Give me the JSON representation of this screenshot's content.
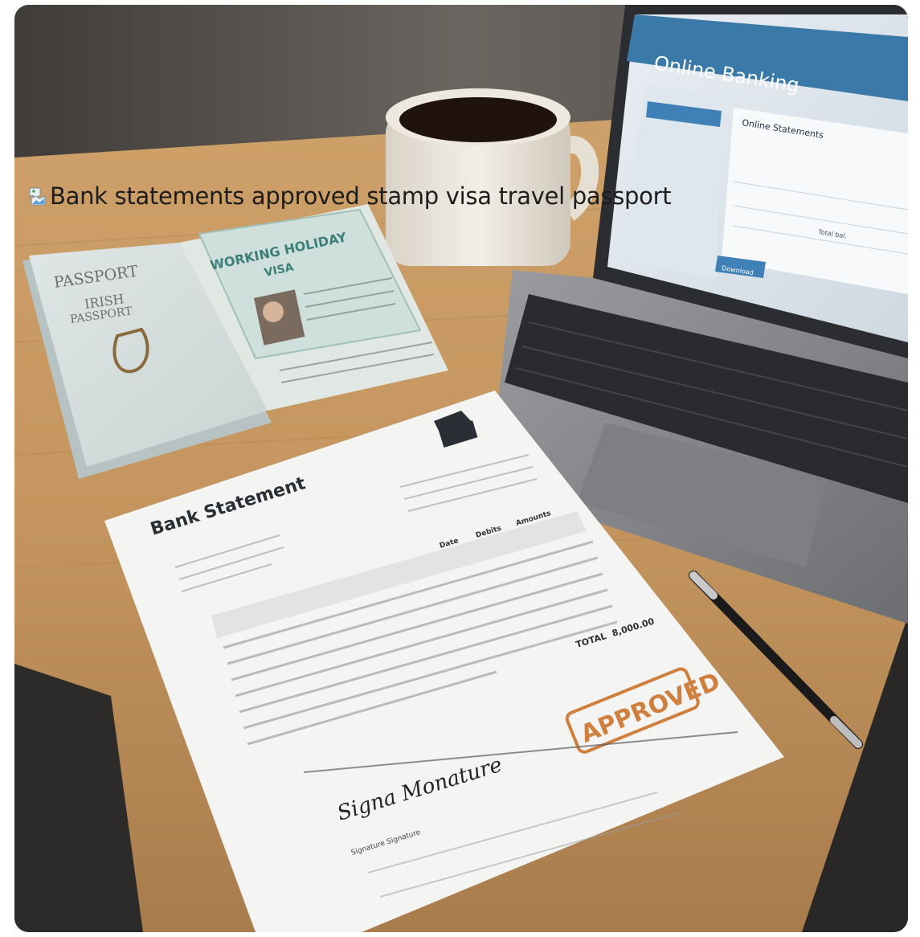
{
  "image": {
    "alt_text": "Bank statements approved stamp visa travel passport",
    "broken_image_icon": "broken-image-icon"
  },
  "scene": {
    "laptop": {
      "title": "Online Banking",
      "panel_heading": "Online Statements",
      "button": "Download",
      "total_label": "Total bal."
    },
    "passport": {
      "cover_word": "PASSPORT",
      "country_line1": "IRISH",
      "country_line2": "PASSPORT",
      "visa_line1": "WORKING HOLIDAY",
      "visa_line2": "VISA"
    },
    "statement": {
      "title": "Bank Statement",
      "date_col": "Date",
      "debits_col": "Debits",
      "amount_col": "Amounts",
      "total_label": "TOTAL",
      "total_value": "8,000.00",
      "stamp": "APPROVED",
      "signature": "Signa Monature",
      "signature_caption": "Signature Signature"
    }
  }
}
